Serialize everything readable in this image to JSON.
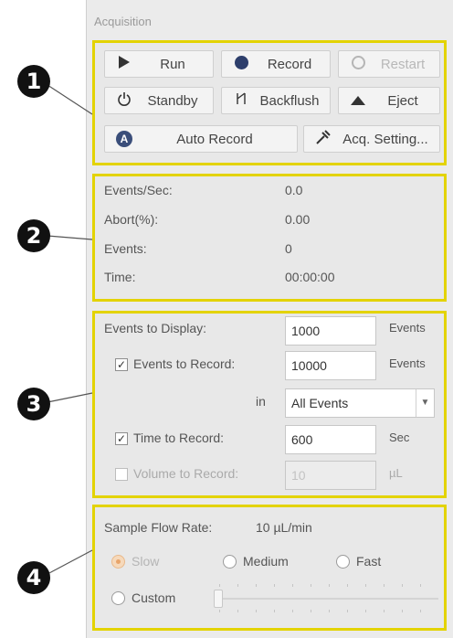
{
  "panel": {
    "title": "Acquisition"
  },
  "callouts": [
    "1",
    "2",
    "3",
    "4"
  ],
  "buttons": {
    "run": "Run",
    "record": "Record",
    "restart": "Restart",
    "standby": "Standby",
    "backflush": "Backflush",
    "eject": "Eject",
    "auto_record": "Auto Record",
    "acq_setting": "Acq. Setting..."
  },
  "stats": {
    "events_sec_label": "Events/Sec:",
    "events_sec_value": "0.0",
    "abort_label": "Abort(%):",
    "abort_value": "0.00",
    "events_label": "Events:",
    "events_value": "0",
    "time_label": "Time:",
    "time_value": "00:00:00"
  },
  "settings": {
    "events_to_display_label": "Events to Display:",
    "events_to_display_value": "1000",
    "events_to_display_unit": "Events",
    "events_to_record_label": "Events to Record:",
    "events_to_record_value": "10000",
    "events_to_record_unit": "Events",
    "events_to_record_checked": true,
    "in_label": "in",
    "gate_value": "All Events",
    "time_to_record_label": "Time to Record:",
    "time_to_record_value": "600",
    "time_to_record_unit": "Sec",
    "time_to_record_checked": true,
    "volume_to_record_label": "Volume to Record:",
    "volume_to_record_value": "10",
    "volume_to_record_unit": "µL",
    "volume_to_record_checked": false
  },
  "flow": {
    "rate_label": "Sample Flow Rate:",
    "rate_value": "10 µL/min",
    "slow": "Slow",
    "medium": "Medium",
    "fast": "Fast",
    "custom": "Custom",
    "selected": "slow"
  },
  "colors": {
    "highlight_border": "#e3d300",
    "selected_radio": "#e8a46a",
    "record_icon": "#2d3e6b"
  }
}
